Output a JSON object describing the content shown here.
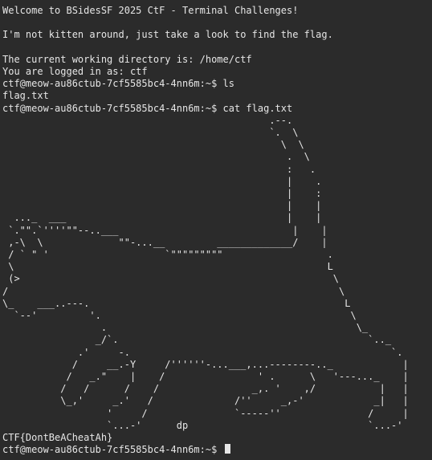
{
  "terminal": {
    "welcome": "Welcome to BSidesSF 2025 CtF - Terminal Challenges!",
    "blank1": "",
    "tagline": "I'm not kitten around, just take a look to find the flag.",
    "blank2": "",
    "cwd_line": "The current working directory is: /home/ctf",
    "login_line": "You are logged in as: ctf",
    "cmd1": "ctf@meow-au86ctub-7cf5585bc4-4nn6m:~$ ls",
    "out1": "flag.txt",
    "cmd2": "ctf@meow-au86ctub-7cf5585bc4-4nn6m:~$ cat flag.txt",
    "ascii_art": "                                              .--.\n                                              `.  \\\n                                                \\  \\\n                                                 .  \\\n                                                 :   .\n                                                 |    .\n                                                 |    :\n                                                 |    |\n  ..._  ___                                      |    |\n `.\"\".`''''\"\"--..___                              |    |\n ,-\\  \\             \"\"-...__         _____________/    |\n / ` \" '                    `\"\"\"\"\"\"\"\"\"                  .\n \\                                                      L\n (>                                                      \\\n/                                                         \\\n\\_    ___..---.                                            L\n  `--'         '.                                           \\\n                 .                                           \\_\n                _/`.                                           `.._\n             .'     -.                                             `.\n            /     __.-Y     /''''''-...___,...--------.._            |\n           /   _.\"    |    /                ' .      \\   '---..._    |\n          /   /      /    /                _,. '    ,/           |   |\n          \\_,'     _.'   /              /''     _,-'            _|   |\n                  '     /               `-----''               /     |\n                  `...-'      dp                               `...-'",
    "flag": "CTF{DontBeACheatAh}",
    "prompt": "ctf@meow-au86ctub-7cf5585bc4-4nn6m:~$ "
  }
}
